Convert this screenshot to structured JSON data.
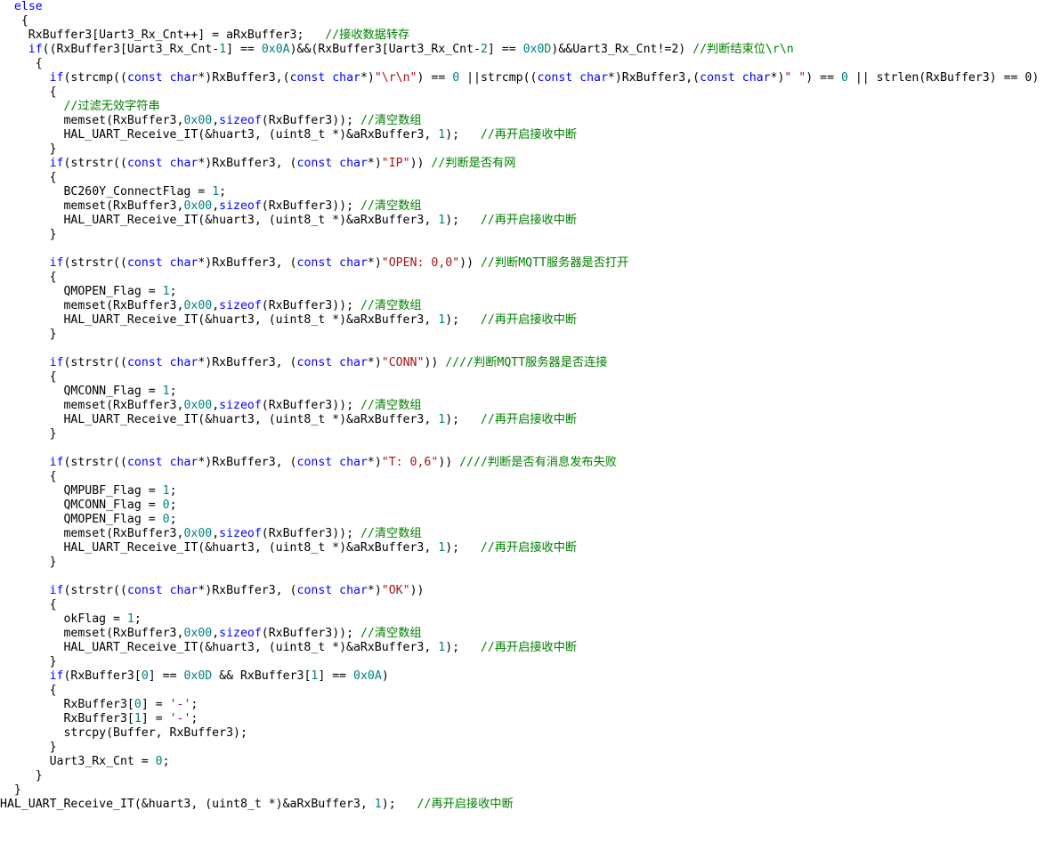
{
  "editor": {
    "lines": [
      [
        {
          "t": "  ",
          "c": "plain"
        },
        {
          "t": "else",
          "c": "kw"
        }
      ],
      [
        {
          "t": "   {",
          "c": "plain"
        }
      ],
      [
        {
          "t": "    RxBuffer3[Uart3_Rx_Cnt++] = aRxBuffer3;   ",
          "c": "plain"
        },
        {
          "t": "//接收数据转存",
          "c": "cmt"
        }
      ],
      [
        {
          "t": "    ",
          "c": "plain"
        },
        {
          "t": "if",
          "c": "kw"
        },
        {
          "t": "((RxBuffer3[Uart3_Rx_Cnt-",
          "c": "plain"
        },
        {
          "t": "1",
          "c": "num"
        },
        {
          "t": "] == ",
          "c": "plain"
        },
        {
          "t": "0x0A",
          "c": "num"
        },
        {
          "t": ")&&(RxBuffer3[Uart3_Rx_Cnt-",
          "c": "plain"
        },
        {
          "t": "2",
          "c": "num"
        },
        {
          "t": "] == ",
          "c": "plain"
        },
        {
          "t": "0x0D",
          "c": "num"
        },
        {
          "t": ")&&Uart3_Rx_Cnt!=2) ",
          "c": "plain"
        },
        {
          "t": "//判断结束位\\r\\n",
          "c": "cmt"
        }
      ],
      [
        {
          "t": "     {",
          "c": "plain"
        }
      ],
      [
        {
          "t": "       ",
          "c": "plain"
        },
        {
          "t": "if",
          "c": "kw"
        },
        {
          "t": "(strcmp((",
          "c": "plain"
        },
        {
          "t": "const char",
          "c": "kw"
        },
        {
          "t": "*)RxBuffer3,(",
          "c": "plain"
        },
        {
          "t": "const char",
          "c": "kw"
        },
        {
          "t": "*)",
          "c": "plain"
        },
        {
          "t": "\"\\r\\n\"",
          "c": "str"
        },
        {
          "t": ") == ",
          "c": "plain"
        },
        {
          "t": "0",
          "c": "num"
        },
        {
          "t": " ||strcmp((",
          "c": "plain"
        },
        {
          "t": "const char",
          "c": "kw"
        },
        {
          "t": "*)RxBuffer3,(",
          "c": "plain"
        },
        {
          "t": "const char",
          "c": "kw"
        },
        {
          "t": "*)",
          "c": "plain"
        },
        {
          "t": "\" \"",
          "c": "str"
        },
        {
          "t": ") == ",
          "c": "plain"
        },
        {
          "t": "0",
          "c": "num"
        },
        {
          "t": " || strlen(RxBuffer3) == 0)",
          "c": "plain"
        }
      ],
      [
        {
          "t": "       {",
          "c": "plain"
        }
      ],
      [
        {
          "t": "         ",
          "c": "plain"
        },
        {
          "t": "//过滤无效字符串",
          "c": "cmt"
        }
      ],
      [
        {
          "t": "         memset(RxBuffer3,",
          "c": "plain"
        },
        {
          "t": "0x00",
          "c": "num"
        },
        {
          "t": ",",
          "c": "plain"
        },
        {
          "t": "sizeof",
          "c": "kw"
        },
        {
          "t": "(RxBuffer3)); ",
          "c": "plain"
        },
        {
          "t": "//清空数组",
          "c": "cmt"
        }
      ],
      [
        {
          "t": "         HAL_UART_Receive_IT(&huart3, (uint8_t *)&aRxBuffer3, ",
          "c": "plain"
        },
        {
          "t": "1",
          "c": "num"
        },
        {
          "t": ");   ",
          "c": "plain"
        },
        {
          "t": "//再开启接收中断",
          "c": "cmt"
        }
      ],
      [
        {
          "t": "       }",
          "c": "plain"
        }
      ],
      [
        {
          "t": "       ",
          "c": "plain"
        },
        {
          "t": "if",
          "c": "kw"
        },
        {
          "t": "(strstr((",
          "c": "plain"
        },
        {
          "t": "const char",
          "c": "kw"
        },
        {
          "t": "*)RxBuffer3, (",
          "c": "plain"
        },
        {
          "t": "const char",
          "c": "kw"
        },
        {
          "t": "*)",
          "c": "plain"
        },
        {
          "t": "\"IP\"",
          "c": "str"
        },
        {
          "t": ")) ",
          "c": "plain"
        },
        {
          "t": "//判断是否有网",
          "c": "cmt"
        }
      ],
      [
        {
          "t": "       {",
          "c": "plain"
        }
      ],
      [
        {
          "t": "         BC260Y_ConnectFlag = ",
          "c": "plain"
        },
        {
          "t": "1",
          "c": "num"
        },
        {
          "t": ";",
          "c": "plain"
        }
      ],
      [
        {
          "t": "         memset(RxBuffer3,",
          "c": "plain"
        },
        {
          "t": "0x00",
          "c": "num"
        },
        {
          "t": ",",
          "c": "plain"
        },
        {
          "t": "sizeof",
          "c": "kw"
        },
        {
          "t": "(RxBuffer3)); ",
          "c": "plain"
        },
        {
          "t": "//清空数组",
          "c": "cmt"
        }
      ],
      [
        {
          "t": "         HAL_UART_Receive_IT(&huart3, (uint8_t *)&aRxBuffer3, ",
          "c": "plain"
        },
        {
          "t": "1",
          "c": "num"
        },
        {
          "t": ");   ",
          "c": "plain"
        },
        {
          "t": "//再开启接收中断",
          "c": "cmt"
        }
      ],
      [
        {
          "t": "       }",
          "c": "plain"
        }
      ],
      [
        {
          "t": "",
          "c": "plain"
        }
      ],
      [
        {
          "t": "       ",
          "c": "plain"
        },
        {
          "t": "if",
          "c": "kw"
        },
        {
          "t": "(strstr((",
          "c": "plain"
        },
        {
          "t": "const char",
          "c": "kw"
        },
        {
          "t": "*)RxBuffer3, (",
          "c": "plain"
        },
        {
          "t": "const char",
          "c": "kw"
        },
        {
          "t": "*)",
          "c": "plain"
        },
        {
          "t": "\"OPEN: 0,0\"",
          "c": "str"
        },
        {
          "t": ")) ",
          "c": "plain"
        },
        {
          "t": "//判断MQTT服务器是否打开",
          "c": "cmt"
        }
      ],
      [
        {
          "t": "       {",
          "c": "plain"
        }
      ],
      [
        {
          "t": "         QMOPEN_Flag = ",
          "c": "plain"
        },
        {
          "t": "1",
          "c": "num"
        },
        {
          "t": ";",
          "c": "plain"
        }
      ],
      [
        {
          "t": "         memset(RxBuffer3,",
          "c": "plain"
        },
        {
          "t": "0x00",
          "c": "num"
        },
        {
          "t": ",",
          "c": "plain"
        },
        {
          "t": "sizeof",
          "c": "kw"
        },
        {
          "t": "(RxBuffer3)); ",
          "c": "plain"
        },
        {
          "t": "//清空数组",
          "c": "cmt"
        }
      ],
      [
        {
          "t": "         HAL_UART_Receive_IT(&huart3, (uint8_t *)&aRxBuffer3, ",
          "c": "plain"
        },
        {
          "t": "1",
          "c": "num"
        },
        {
          "t": ");   ",
          "c": "plain"
        },
        {
          "t": "//再开启接收中断",
          "c": "cmt"
        }
      ],
      [
        {
          "t": "       }",
          "c": "plain"
        }
      ],
      [
        {
          "t": "",
          "c": "plain"
        }
      ],
      [
        {
          "t": "       ",
          "c": "plain"
        },
        {
          "t": "if",
          "c": "kw"
        },
        {
          "t": "(strstr((",
          "c": "plain"
        },
        {
          "t": "const char",
          "c": "kw"
        },
        {
          "t": "*)RxBuffer3, (",
          "c": "plain"
        },
        {
          "t": "const char",
          "c": "kw"
        },
        {
          "t": "*)",
          "c": "plain"
        },
        {
          "t": "\"CONN\"",
          "c": "str"
        },
        {
          "t": ")) ",
          "c": "plain"
        },
        {
          "t": "////判断MQTT服务器是否连接",
          "c": "cmt"
        }
      ],
      [
        {
          "t": "       {",
          "c": "plain"
        }
      ],
      [
        {
          "t": "         QMCONN_Flag = ",
          "c": "plain"
        },
        {
          "t": "1",
          "c": "num"
        },
        {
          "t": ";",
          "c": "plain"
        }
      ],
      [
        {
          "t": "         memset(RxBuffer3,",
          "c": "plain"
        },
        {
          "t": "0x00",
          "c": "num"
        },
        {
          "t": ",",
          "c": "plain"
        },
        {
          "t": "sizeof",
          "c": "kw"
        },
        {
          "t": "(RxBuffer3)); ",
          "c": "plain"
        },
        {
          "t": "//清空数组",
          "c": "cmt"
        }
      ],
      [
        {
          "t": "         HAL_UART_Receive_IT(&huart3, (uint8_t *)&aRxBuffer3, ",
          "c": "plain"
        },
        {
          "t": "1",
          "c": "num"
        },
        {
          "t": ");   ",
          "c": "plain"
        },
        {
          "t": "//再开启接收中断",
          "c": "cmt"
        }
      ],
      [
        {
          "t": "       }",
          "c": "plain"
        }
      ],
      [
        {
          "t": "",
          "c": "plain"
        }
      ],
      [
        {
          "t": "       ",
          "c": "plain"
        },
        {
          "t": "if",
          "c": "kw"
        },
        {
          "t": "(strstr((",
          "c": "plain"
        },
        {
          "t": "const char",
          "c": "kw"
        },
        {
          "t": "*)RxBuffer3, (",
          "c": "plain"
        },
        {
          "t": "const char",
          "c": "kw"
        },
        {
          "t": "*)",
          "c": "plain"
        },
        {
          "t": "\"T: 0,6\"",
          "c": "str"
        },
        {
          "t": ")) ",
          "c": "plain"
        },
        {
          "t": "////判断是否有消息发布失败",
          "c": "cmt"
        }
      ],
      [
        {
          "t": "       {",
          "c": "plain"
        }
      ],
      [
        {
          "t": "         QMPUBF_Flag = ",
          "c": "plain"
        },
        {
          "t": "1",
          "c": "num"
        },
        {
          "t": ";",
          "c": "plain"
        }
      ],
      [
        {
          "t": "         QMCONN_Flag = ",
          "c": "plain"
        },
        {
          "t": "0",
          "c": "num"
        },
        {
          "t": ";",
          "c": "plain"
        }
      ],
      [
        {
          "t": "         QMOPEN_Flag = ",
          "c": "plain"
        },
        {
          "t": "0",
          "c": "num"
        },
        {
          "t": ";",
          "c": "plain"
        }
      ],
      [
        {
          "t": "         memset(RxBuffer3,",
          "c": "plain"
        },
        {
          "t": "0x00",
          "c": "num"
        },
        {
          "t": ",",
          "c": "plain"
        },
        {
          "t": "sizeof",
          "c": "kw"
        },
        {
          "t": "(RxBuffer3)); ",
          "c": "plain"
        },
        {
          "t": "//清空数组",
          "c": "cmt"
        }
      ],
      [
        {
          "t": "         HAL_UART_Receive_IT(&huart3, (uint8_t *)&aRxBuffer3, ",
          "c": "plain"
        },
        {
          "t": "1",
          "c": "num"
        },
        {
          "t": ");   ",
          "c": "plain"
        },
        {
          "t": "//再开启接收中断",
          "c": "cmt"
        }
      ],
      [
        {
          "t": "       }",
          "c": "plain"
        }
      ],
      [
        {
          "t": "",
          "c": "plain"
        }
      ],
      [
        {
          "t": "       ",
          "c": "plain"
        },
        {
          "t": "if",
          "c": "kw"
        },
        {
          "t": "(strstr((",
          "c": "plain"
        },
        {
          "t": "const char",
          "c": "kw"
        },
        {
          "t": "*)RxBuffer3, (",
          "c": "plain"
        },
        {
          "t": "const char",
          "c": "kw"
        },
        {
          "t": "*)",
          "c": "plain"
        },
        {
          "t": "\"OK\"",
          "c": "str"
        },
        {
          "t": "))",
          "c": "plain"
        }
      ],
      [
        {
          "t": "       {",
          "c": "plain"
        }
      ],
      [
        {
          "t": "         okFlag = ",
          "c": "plain"
        },
        {
          "t": "1",
          "c": "num"
        },
        {
          "t": ";",
          "c": "plain"
        }
      ],
      [
        {
          "t": "         memset(RxBuffer3,",
          "c": "plain"
        },
        {
          "t": "0x00",
          "c": "num"
        },
        {
          "t": ",",
          "c": "plain"
        },
        {
          "t": "sizeof",
          "c": "kw"
        },
        {
          "t": "(RxBuffer3)); ",
          "c": "plain"
        },
        {
          "t": "//清空数组",
          "c": "cmt"
        }
      ],
      [
        {
          "t": "         HAL_UART_Receive_IT(&huart3, (uint8_t *)&aRxBuffer3, ",
          "c": "plain"
        },
        {
          "t": "1",
          "c": "num"
        },
        {
          "t": ");   ",
          "c": "plain"
        },
        {
          "t": "//再开启接收中断",
          "c": "cmt"
        }
      ],
      [
        {
          "t": "       }",
          "c": "plain"
        }
      ],
      [
        {
          "t": "       ",
          "c": "plain"
        },
        {
          "t": "if",
          "c": "kw"
        },
        {
          "t": "(RxBuffer3[",
          "c": "plain"
        },
        {
          "t": "0",
          "c": "num"
        },
        {
          "t": "] == ",
          "c": "plain"
        },
        {
          "t": "0x0D",
          "c": "num"
        },
        {
          "t": " && RxBuffer3[",
          "c": "plain"
        },
        {
          "t": "1",
          "c": "num"
        },
        {
          "t": "] == ",
          "c": "plain"
        },
        {
          "t": "0x0A",
          "c": "num"
        },
        {
          "t": ")",
          "c": "plain"
        }
      ],
      [
        {
          "t": "       {",
          "c": "plain"
        }
      ],
      [
        {
          "t": "         RxBuffer3[",
          "c": "plain"
        },
        {
          "t": "0",
          "c": "num"
        },
        {
          "t": "] = ",
          "c": "plain"
        },
        {
          "t": "'-'",
          "c": "chr"
        },
        {
          "t": ";",
          "c": "plain"
        }
      ],
      [
        {
          "t": "         RxBuffer3[",
          "c": "plain"
        },
        {
          "t": "1",
          "c": "num"
        },
        {
          "t": "] = ",
          "c": "plain"
        },
        {
          "t": "'-'",
          "c": "chr"
        },
        {
          "t": ";",
          "c": "plain"
        }
      ],
      [
        {
          "t": "         strcpy(Buffer, RxBuffer3);",
          "c": "plain"
        }
      ],
      [
        {
          "t": "       }",
          "c": "plain"
        }
      ],
      [
        {
          "t": "       Uart3_Rx_Cnt = ",
          "c": "plain"
        },
        {
          "t": "0",
          "c": "num"
        },
        {
          "t": ";",
          "c": "plain"
        }
      ],
      [
        {
          "t": "     }",
          "c": "plain"
        }
      ],
      [
        {
          "t": "  }",
          "c": "plain"
        }
      ],
      [
        {
          "t": "HAL_UART_Receive_IT(&huart3, (uint8_t *)&aRxBuffer3, ",
          "c": "plain"
        },
        {
          "t": "1",
          "c": "num"
        },
        {
          "t": ");   ",
          "c": "plain"
        },
        {
          "t": "//再开启接收中断",
          "c": "cmt"
        }
      ]
    ]
  }
}
